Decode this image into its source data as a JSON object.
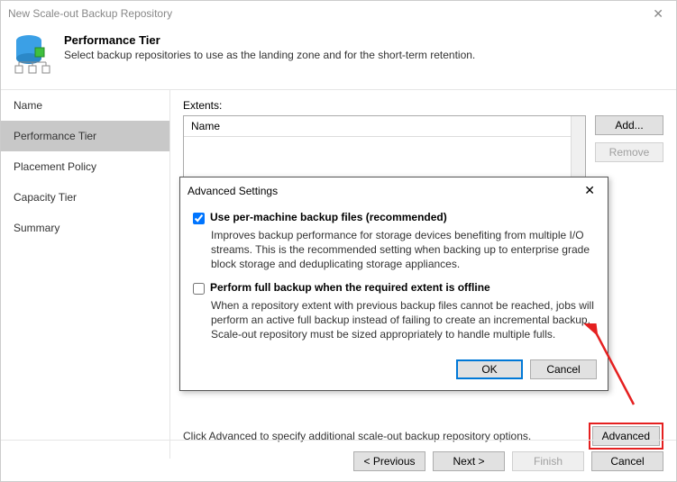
{
  "window": {
    "title": "New Scale-out Backup Repository"
  },
  "header": {
    "title": "Performance Tier",
    "subtitle": "Select backup repositories to use as the landing zone and for the short-term retention."
  },
  "sidebar": {
    "items": [
      {
        "label": "Name"
      },
      {
        "label": "Performance Tier"
      },
      {
        "label": "Placement Policy"
      },
      {
        "label": "Capacity Tier"
      },
      {
        "label": "Summary"
      }
    ]
  },
  "main": {
    "extents_label": "Extents:",
    "column_header": "Name",
    "add_label": "Add...",
    "remove_label": "Remove",
    "hint": "Click Advanced to specify additional scale-out backup repository options.",
    "advanced_label": "Advanced"
  },
  "modal": {
    "title": "Advanced Settings",
    "opt1_label": "Use per-machine backup files (recommended)",
    "opt1_desc": "Improves backup performance for storage devices benefiting from multiple I/O streams. This is the recommended setting when backing up to enterprise grade block storage and deduplicating storage appliances.",
    "opt2_label": "Perform full backup when the required extent is offline",
    "opt2_desc": "When a repository extent with previous backup files cannot be reached, jobs will perform an active full backup instead of failing to create an incremental backup. Scale-out repository must be sized appropriately to handle multiple fulls.",
    "ok_label": "OK",
    "cancel_label": "Cancel"
  },
  "footer": {
    "previous": "< Previous",
    "next": "Next >",
    "finish": "Finish",
    "cancel": "Cancel"
  }
}
